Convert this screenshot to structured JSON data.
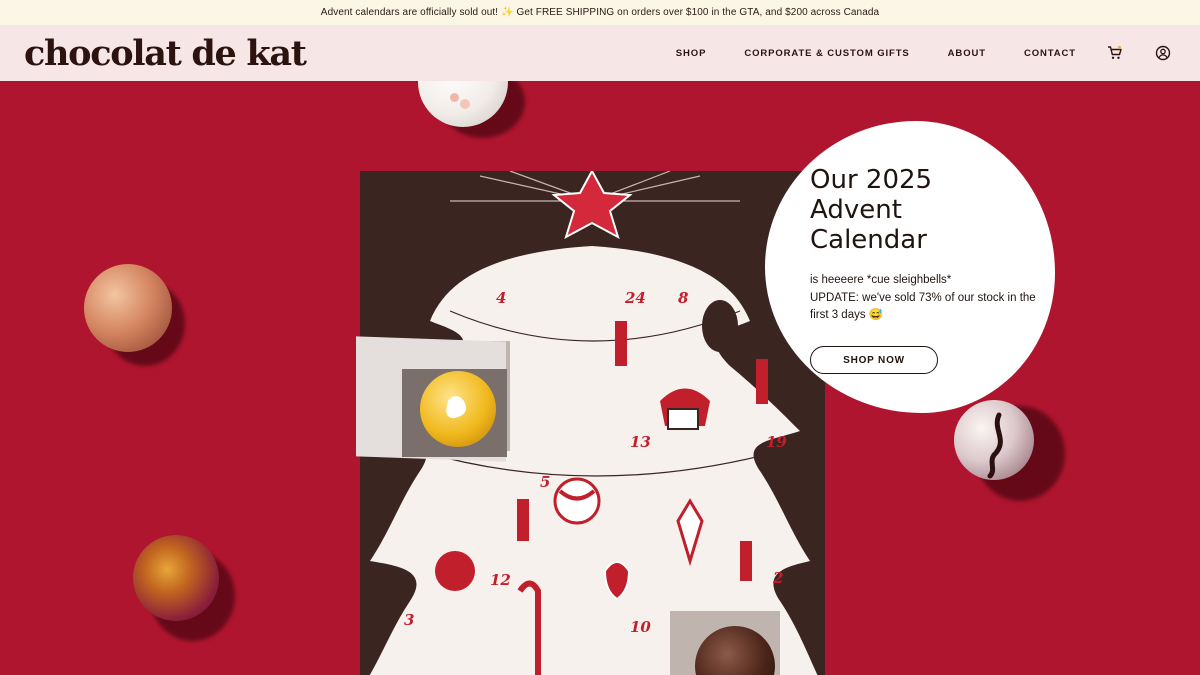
{
  "announcement": "Advent calendars are officially sold out! ✨ Get FREE SHIPPING on orders over $100 in the GTA, and $200 across Canada",
  "header": {
    "logo": "chocolat de kat",
    "nav": [
      "SHOP",
      "CORPORATE & CUSTOM GIFTS",
      "ABOUT",
      "CONTACT"
    ],
    "icons": [
      "cart-icon",
      "account-icon"
    ]
  },
  "hero": {
    "title": "Our 2025 Advent Calendar",
    "text_line1": "is heeeere *cue sleighbells*",
    "text_line2": "UPDATE: we've sold 73% of our stock in the first 3 days 😅",
    "cta": "SHOP NOW"
  },
  "calendar_numbers": [
    "4",
    "24",
    "8",
    "13",
    "19",
    "5",
    "12",
    "2",
    "3",
    "10"
  ],
  "colors": {
    "background": "#b0152f",
    "announcement_bg": "#fbf6e6",
    "header_bg": "#f7e6e6",
    "text_dark": "#2b1410",
    "calendar_red": "#c01f2b"
  }
}
